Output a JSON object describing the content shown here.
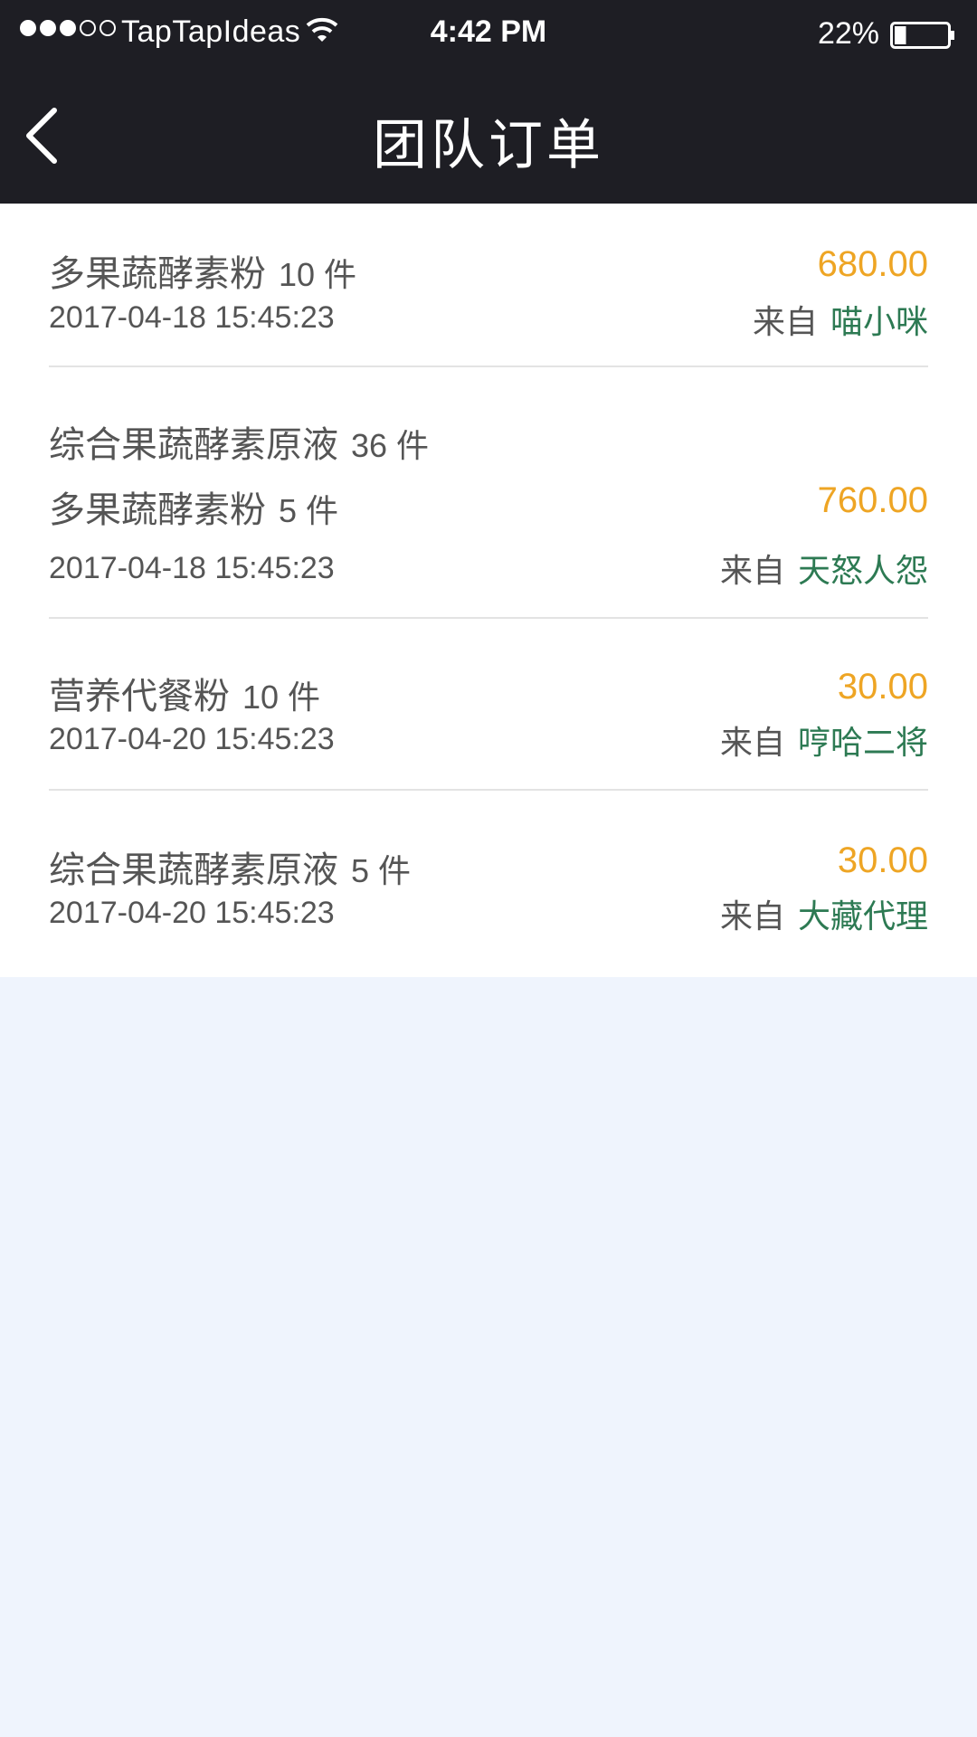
{
  "status_bar": {
    "carrier": "TapTapIdeas",
    "time": "4:42 PM",
    "battery": "22%",
    "signal_icon": "signal-dots-icon",
    "wifi_icon": "wifi-icon",
    "battery_icon": "battery-icon",
    "battery_level": 0.22
  },
  "nav": {
    "title": "团队订单",
    "back_icon": "chevron-left-icon"
  },
  "colors": {
    "header_bg": "#1e1e24",
    "amount": "#eea524",
    "sender": "#2d7a53",
    "page_bg": "#eff4fd"
  },
  "orders": [
    {
      "items": [
        {
          "name": "多果蔬酵素粉",
          "qty": "10 件"
        }
      ],
      "date": "2017-04-18 15:45:23",
      "amount": "680.00",
      "from_label": "来自",
      "sender": "喵小咪"
    },
    {
      "items": [
        {
          "name": "综合果蔬酵素原液",
          "qty": "36 件"
        },
        {
          "name": "多果蔬酵素粉",
          "qty": "5 件"
        }
      ],
      "date": "2017-04-18 15:45:23",
      "amount": "760.00",
      "from_label": "来自",
      "sender": "天怒人怨"
    },
    {
      "items": [
        {
          "name": "营养代餐粉",
          "qty": "10 件"
        }
      ],
      "date": "2017-04-20 15:45:23",
      "amount": "30.00",
      "from_label": "来自",
      "sender": "哼哈二将"
    },
    {
      "items": [
        {
          "name": "综合果蔬酵素原液",
          "qty": "5 件"
        }
      ],
      "date": "2017-04-20 15:45:23",
      "amount": "30.00",
      "from_label": "来自",
      "sender": "大藏代理"
    }
  ]
}
